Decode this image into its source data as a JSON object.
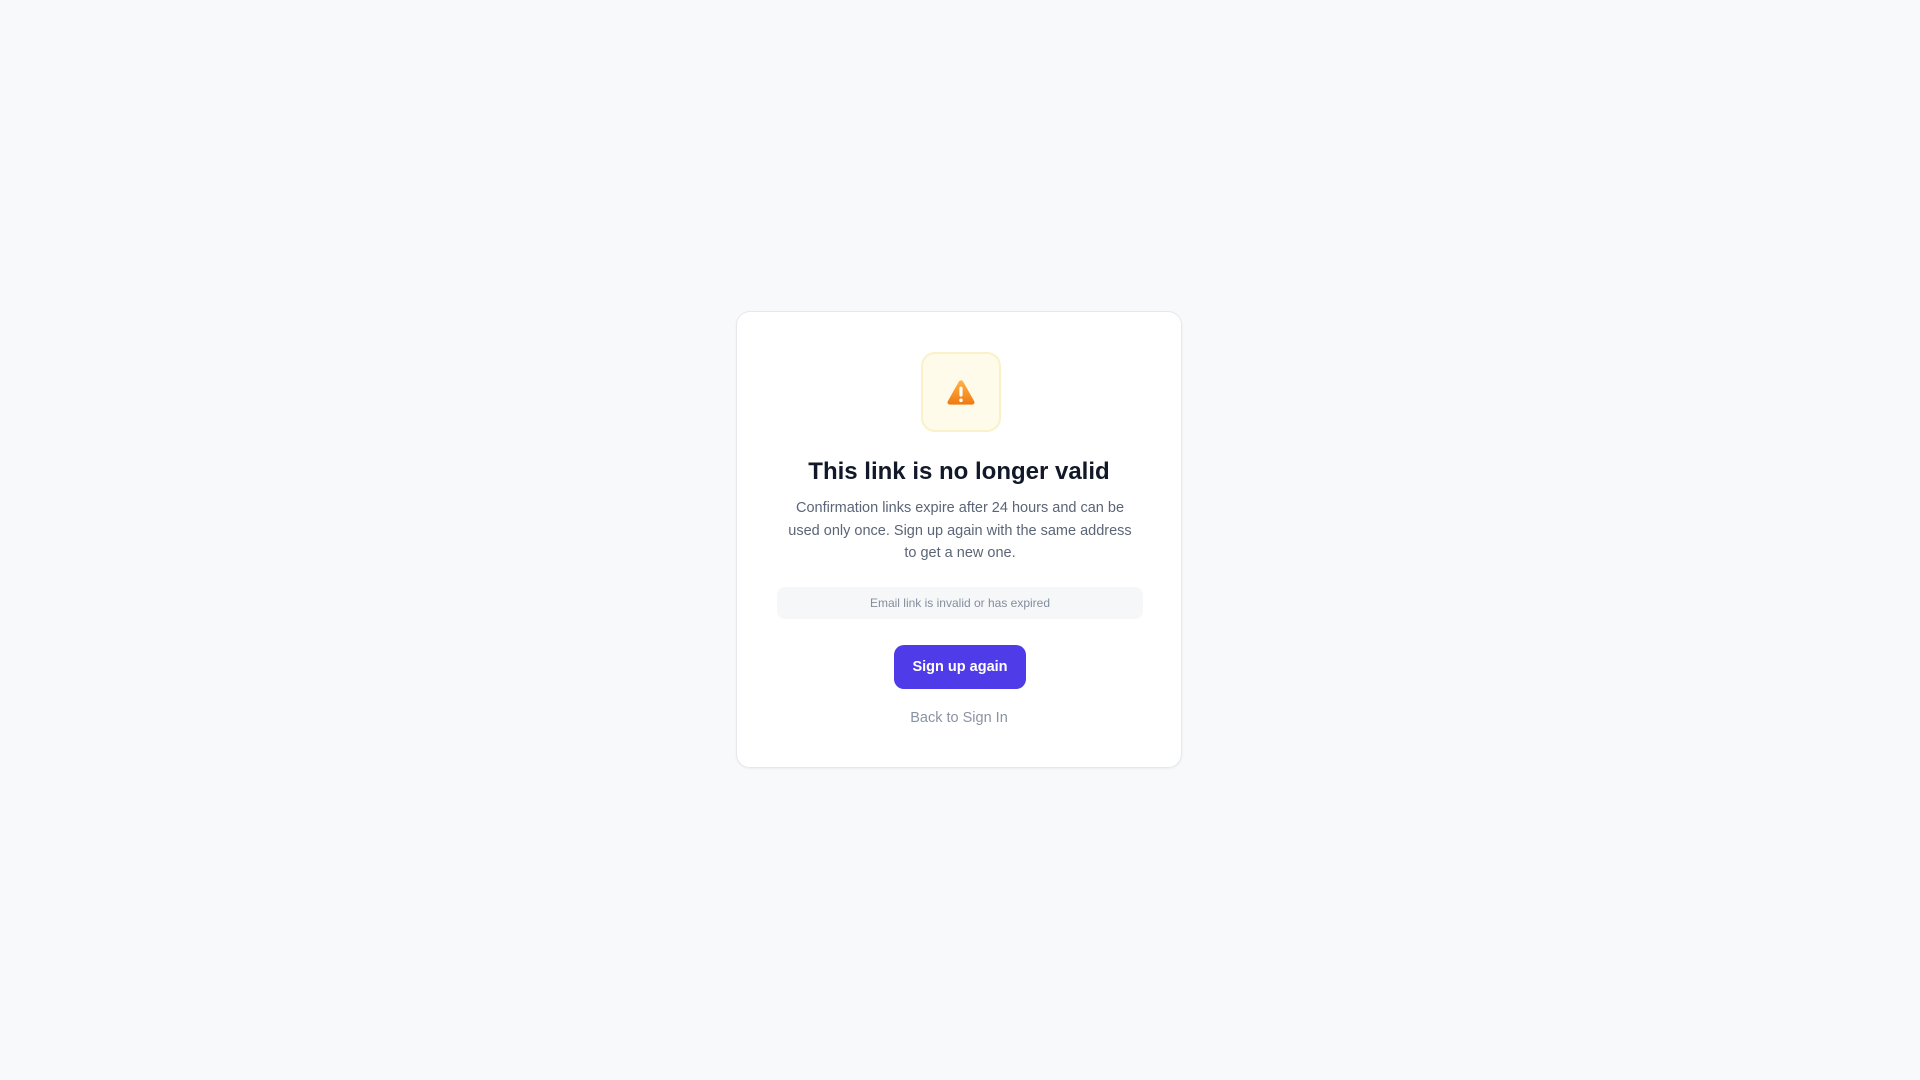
{
  "card": {
    "icon": "warning-triangle-icon",
    "title": "This link is no longer valid",
    "description": "Confirmation links expire after 24 hours and can be used only once. Sign up again with the same address to get a new one.",
    "error_message": "Email link is invalid or has expired",
    "primary_button_label": "Sign up again",
    "back_link_label": "Back to Sign In"
  },
  "colors": {
    "background": "#f8f9fb",
    "primary": "#4f3be8",
    "warning": "#f28a1e"
  }
}
